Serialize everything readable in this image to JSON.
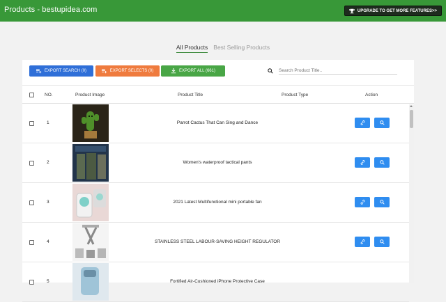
{
  "header": {
    "title": "Products - bestupidea.com",
    "upgrade_label": "UPGRADE TO GET MORE FEATURES>>"
  },
  "tabs": [
    {
      "label": "All Products",
      "active": true
    },
    {
      "label": "Best Selling Products",
      "active": false
    }
  ],
  "toolbar": {
    "export_search": "EXPORT SEARCH (0)",
    "export_selects": "EXPORT SELECTS (0)",
    "export_all": "EXPORT ALL (661)",
    "search_placeholder": "Search Product Title.."
  },
  "table": {
    "headers": {
      "no": "NO.",
      "image": "Product Image",
      "title": "Product Title",
      "type": "Product Type",
      "action": "Action"
    },
    "rows": [
      {
        "no": "1",
        "title": "Parrot Cactus That Can Sing and Dance"
      },
      {
        "no": "2",
        "title": "Women's waterproof tactical pants"
      },
      {
        "no": "3",
        "title": "2021 Latest Multifunctional mini portable fan"
      },
      {
        "no": "4",
        "title": "STAINLESS STEEL LABOUR-SAVING HEIGHT REGULATOR"
      },
      {
        "no": "5",
        "title": "Fortified Air-Cushioned iPhone Protective Case"
      }
    ]
  },
  "colors": {
    "header_green": "#389838",
    "blue": "#2f6fd8",
    "orange": "#ef7b3e",
    "green": "#49a646",
    "action_blue": "#2f8df0"
  }
}
